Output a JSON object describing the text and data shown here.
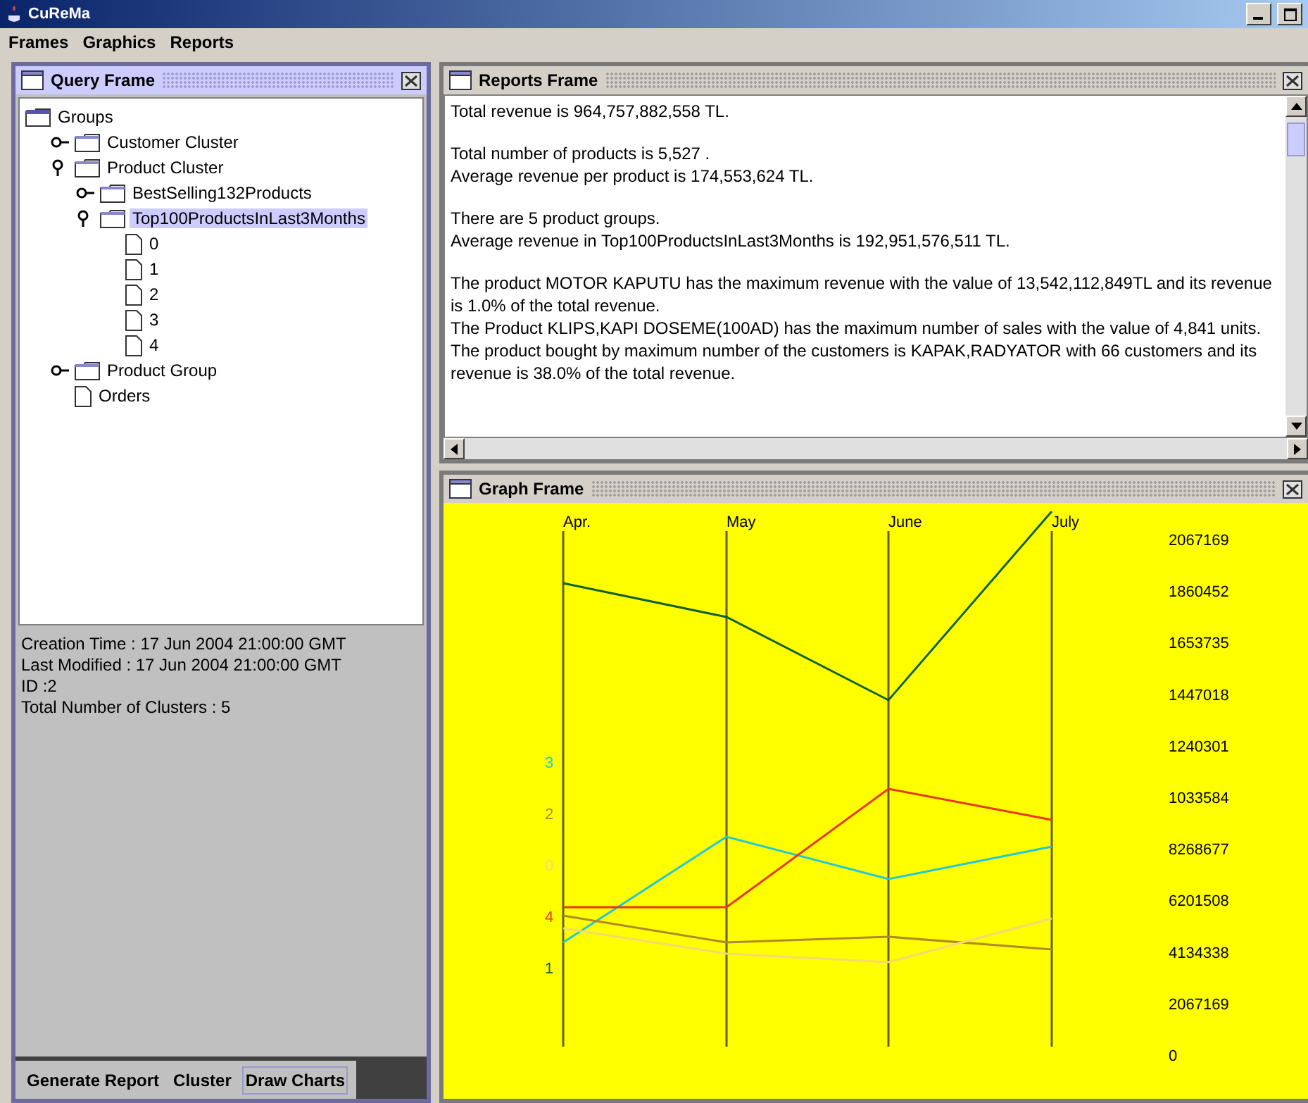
{
  "window": {
    "title": "CuReMa"
  },
  "menu": [
    "Frames",
    "Graphics",
    "Reports"
  ],
  "query_frame": {
    "title": "Query Frame",
    "tree": [
      {
        "label": "Groups",
        "kind": "folder",
        "expanded": true,
        "selected": false,
        "children": [
          {
            "label": "Customer Cluster",
            "kind": "folder",
            "expanded": false,
            "selected": false
          },
          {
            "label": "Product Cluster",
            "kind": "folder",
            "expanded": true,
            "selected": false,
            "children": [
              {
                "label": "BestSelling132Products",
                "kind": "folder",
                "expanded": false,
                "selected": false
              },
              {
                "label": "Top100ProductsInLast3Months",
                "kind": "folder",
                "expanded": true,
                "selected": true,
                "children": [
                  {
                    "label": "0",
                    "kind": "file",
                    "selected": false
                  },
                  {
                    "label": "1",
                    "kind": "file",
                    "selected": false
                  },
                  {
                    "label": "2",
                    "kind": "file",
                    "selected": false
                  },
                  {
                    "label": "3",
                    "kind": "file",
                    "selected": false
                  },
                  {
                    "label": "4",
                    "kind": "file",
                    "selected": false
                  }
                ]
              }
            ]
          },
          {
            "label": "Product Group",
            "kind": "folder",
            "expanded": false,
            "selected": false
          },
          {
            "label": "Orders",
            "kind": "file",
            "selected": false
          }
        ]
      }
    ],
    "details": [
      "Creation Time : 17 Jun 2004 21:00:00 GMT",
      "Last Modified : 17 Jun 2004 21:00:00 GMT",
      "ID :2",
      "Total Number of Clusters : 5"
    ],
    "tabs": [
      {
        "label": "Generate Report",
        "selected": false
      },
      {
        "label": "Cluster",
        "selected": false
      },
      {
        "label": "Draw Charts",
        "selected": true
      }
    ]
  },
  "reports_frame": {
    "title": "Reports Frame",
    "paragraphs": [
      [
        "Total revenue is 964,757,882,558 TL."
      ],
      [
        "Total number of products is 5,527 .",
        "Average revenue per product is 174,553,624 TL."
      ],
      [
        "There are 5 product groups.",
        "Average revenue in Top100ProductsInLast3Months is 192,951,576,511 TL."
      ],
      [
        "The product MOTOR KAPUTU has the maximum revenue with the value of 13,542,112,849TL and its revenue is 1.0% of the total revenue.",
        "The Product KLIPS,KAPI DOSEME(100AD) has the maximum number of sales with the value of 4,841 units.",
        "The product bought by maximum number of the customers is KAPAK,RADYATOR with 66 customers and its revenue is 38.0% of the total revenue."
      ]
    ]
  },
  "graph_frame": {
    "title": "Graph Frame",
    "months": [
      "Apr.",
      "May",
      "June",
      "July"
    ],
    "scale_labels": [
      "2067169",
      "1860452",
      "1653735",
      "1447018",
      "1240301",
      "1033584",
      "8268677",
      "6201508",
      "4134338",
      "2067169",
      "0"
    ],
    "clusters": [
      {
        "label": "3",
        "color": "#22c8d8"
      },
      {
        "label": "2",
        "color": "#b08a2a"
      },
      {
        "label": "0",
        "color": "#f8d870"
      },
      {
        "label": "4",
        "color": "#e83818"
      },
      {
        "label": "1",
        "color": "#106030"
      }
    ]
  }
}
